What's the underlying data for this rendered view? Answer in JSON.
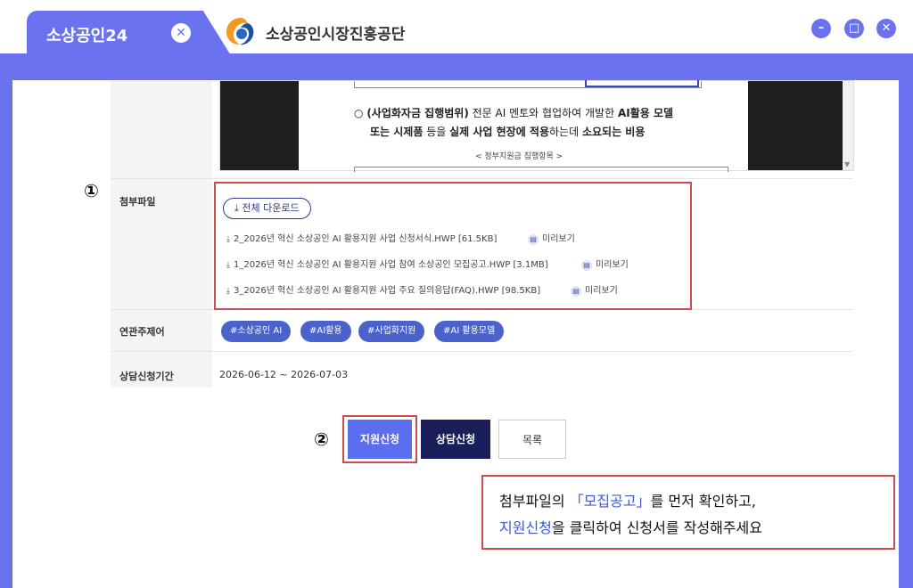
{
  "window": {
    "tab_title": "소상공인24",
    "tab_close": "✕",
    "site_title": "소상공인시장진흥공단",
    "buttons": {
      "minimize": "–",
      "maximize": "□",
      "close": "✕"
    }
  },
  "viewer": {
    "bullet": "○",
    "line1_bold": "(사업화자금 집행범위)",
    "line1_text": " 전문 AI 멘토와 협업하여 개발한 ",
    "line1_bold2": "AI활용 모델",
    "line2_bold": "또는 시제품",
    "line2_text": " 등을 ",
    "line2_bold2": "실제 사업 현장에 적용",
    "line2_text2": "하는데 ",
    "line2_bold3": "소요되는 비용",
    "caption": "< 정부지원금 집행항목 >"
  },
  "markers": {
    "one": "①",
    "two": "②"
  },
  "attachments": {
    "label": "첨부파일",
    "download_all": "전체 다운로드",
    "preview_label": "미리보기",
    "files": [
      "2_2026년 혁신 소상공인 AI 활용지원 사업 신청서식.HWP [61.5KB]",
      "1_2026년 혁신 소상공인 AI 활용지원 사업 참여 소상공인 모집공고.HWP [3.1MB]",
      "3_2026년 혁신 소상공인 AI 활용지원 사업 주요 질의응답(FAQ).HWP [98.5KB]"
    ]
  },
  "tags": {
    "label": "연관주제어",
    "items": [
      "#소상공인 AI",
      "#AI활용",
      "#사업화지원",
      "#AI 활용모델"
    ]
  },
  "period": {
    "label": "상담신청기간",
    "value": "2026-06-12 ~ 2026-07-03"
  },
  "actions": {
    "apply": "지원신청",
    "consult": "상담신청",
    "list": "목록"
  },
  "note": {
    "l1_a": "첨부파일의 ",
    "l1_hl": "「모집공고」",
    "l1_b": "를 먼저 확인하고,",
    "l2_hl": "지원신청",
    "l2_b": "을 클릭하여 신청서를 작성해주세요"
  },
  "colors": {
    "accent": "#6b72f0",
    "tag": "#4a62c9",
    "dark_button": "#1a1f5c",
    "highlight": "#d0494d"
  }
}
